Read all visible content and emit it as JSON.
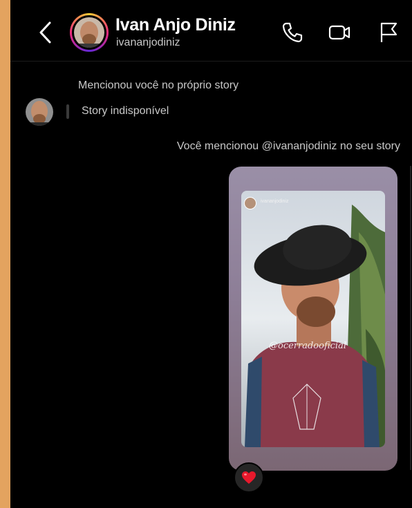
{
  "header": {
    "name": "Ivan Anjo Diniz",
    "username": "ivananjodiniz",
    "icons": [
      "back-chevron-icon",
      "phone-icon",
      "video-camera-icon",
      "flag-icon"
    ]
  },
  "messages": {
    "mention_label": "Mencionou você no próprio story",
    "story_unavailable": "Story indisponível",
    "you_mentioned": "Você mencionou @ivananjodiniz no seu story"
  },
  "story": {
    "tag_username": "ivananjodiniz",
    "overlay_handle": "@ocerradooficial"
  },
  "reaction": {
    "emoji": "❤️"
  },
  "colors": {
    "accent_strip": "#e3a35f",
    "background": "#000000",
    "secondary_text": "#c9c9c9"
  }
}
